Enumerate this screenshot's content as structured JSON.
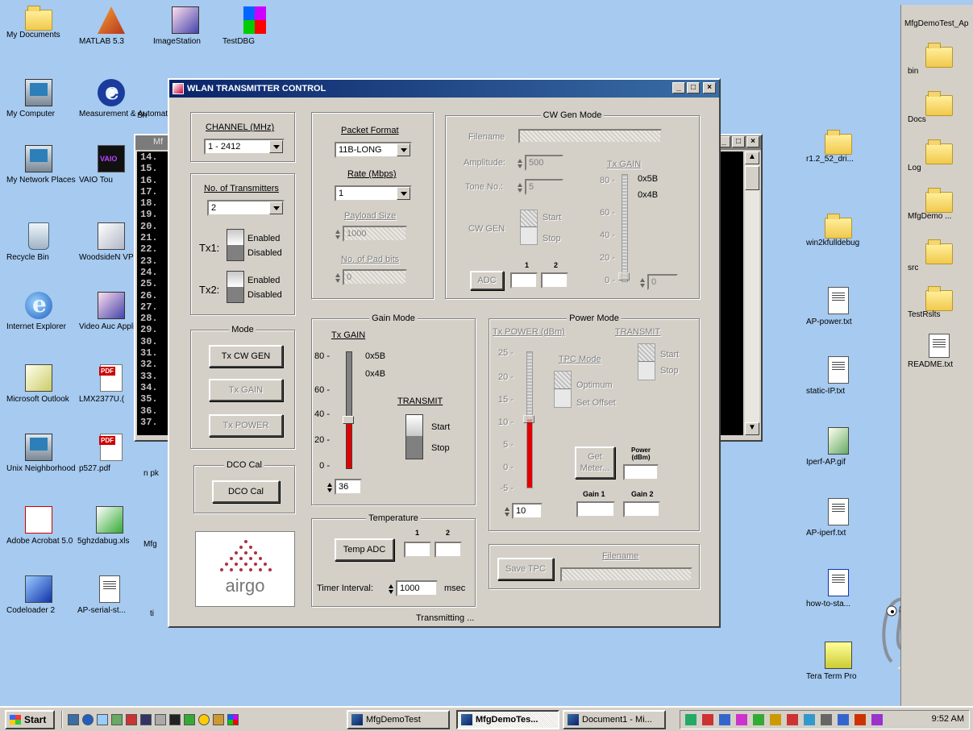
{
  "desktop": {
    "icons": [
      {
        "label": "My Documents"
      },
      {
        "label": "MATLAB 5.3"
      },
      {
        "label": "ImageStation"
      },
      {
        "label": "TestDBG"
      },
      {
        "label": "My Computer"
      },
      {
        "label": "Measurement & Automatio..."
      },
      {
        "label": "Sh"
      },
      {
        "label": "My Network Places"
      },
      {
        "label": "VAIO Tou"
      },
      {
        "label": "Recycle Bin"
      },
      {
        "label": "WoodsideN VPN"
      },
      {
        "label": "Internet Explorer"
      },
      {
        "label": "Video Auc Applicatio"
      },
      {
        "label": "Microsoft Outlook"
      },
      {
        "label": "LMX2377U.("
      },
      {
        "label": "Unix Neighborhood"
      },
      {
        "label": "p527.pdf"
      },
      {
        "label": "n pk"
      },
      {
        "label": "Adobe Acrobat 5.0"
      },
      {
        "label": "5ghzdabug.xls"
      },
      {
        "label": "Mfg"
      },
      {
        "label": "Codeloader 2"
      },
      {
        "label": "AP-serial-st..."
      },
      {
        "label": "ti"
      },
      {
        "label": "r1.2_52_dri..."
      },
      {
        "label": "win2kfulldebug"
      },
      {
        "label": "AP-power.txt"
      },
      {
        "label": "static-IP.txt"
      },
      {
        "label": "Iperf-AP.gif"
      },
      {
        "label": "AP-iperf.txt"
      },
      {
        "label": "how-to-sta..."
      },
      {
        "label": "Tera Term Pro"
      }
    ]
  },
  "right_panel": {
    "title": "MfgDemoTest_Ap",
    "items": [
      {
        "label": "bin"
      },
      {
        "label": "Docs"
      },
      {
        "label": "Log"
      },
      {
        "label": "MfgDemo ..."
      },
      {
        "label": "src"
      },
      {
        "label": "TestRslts"
      },
      {
        "label": "README.txt"
      }
    ]
  },
  "cmd_window": {
    "title": "Mf",
    "lines": [
      "14.",
      "15.",
      "16.",
      "17.",
      "18.",
      "19.",
      "20.",
      "21.",
      "22.",
      "23.",
      "24.",
      "25.",
      "26.",
      "27.",
      "28.",
      "29.",
      "30.",
      "31.",
      "32.",
      "33.",
      "34.",
      "35.",
      "36.",
      "37."
    ]
  },
  "dialog": {
    "title": "WLAN TRANSMITTER CONTROL",
    "channel": {
      "label": "CHANNEL (MHz)",
      "value": "1 - 2412"
    },
    "transmitters": {
      "label": "No. of Transmitters",
      "value": "2",
      "tx1_label": "Tx1:",
      "tx2_label": "Tx2:",
      "enabled": "Enabled",
      "disabled": "Disabled"
    },
    "mode": {
      "title": "Mode",
      "tx_cw_gen": "Tx CW GEN",
      "tx_gain": "Tx GAIN",
      "tx_power": "Tx POWER"
    },
    "dco_cal": {
      "title": "DCO Cal",
      "button": "DCO Cal"
    },
    "logo_text": "airgo",
    "packet": {
      "format_label": "Packet Format",
      "format_value": "11B-LONG",
      "rate_label": "Rate (Mbps)",
      "rate_value": "1",
      "payload_label": "Payload Size",
      "payload_value": "1000",
      "pad_label": "No. of Pad bits",
      "pad_value": "0"
    },
    "cw_gen": {
      "title": "CW Gen Mode",
      "filename_label": "Filename",
      "amplitude_label": "Amplitude:",
      "amplitude_value": "500",
      "tone_label": "Tone No.:",
      "tone_value": "5",
      "cw_gen_label": "CW GEN",
      "start": "Start",
      "stop": "Stop",
      "adc_button": "ADC",
      "col1": "1",
      "col2": "2",
      "txgain_label": "Tx GAIN",
      "ticks": [
        "80 -",
        "60 -",
        "40 -",
        "20 -",
        "0 -"
      ],
      "marker_high": "0x5B",
      "marker_low": "0x4B",
      "gain_value": "0"
    },
    "gain_mode": {
      "title": "Gain Mode",
      "tx_gain_label": "Tx GAIN",
      "ticks": [
        "80 -",
        "60 -",
        "40 -",
        "20 -",
        "0 -"
      ],
      "marker_high": "0x5B",
      "marker_low": "0x4B",
      "transmit_label": "TRANSMIT",
      "start": "Start",
      "stop": "Stop",
      "gain_value": "36",
      "level": 36
    },
    "power_mode": {
      "title": "Power Mode",
      "tx_power_label": "Tx POWER (dBm)",
      "transmit_label": "TRANSMIT",
      "tpc_mode_label": "TPC Mode",
      "optimum": "Optimum",
      "set_offset": "Set Offset",
      "start": "Start",
      "stop": "Stop",
      "ticks": [
        "25 -",
        "20 -",
        "15 -",
        "10 -",
        "5 -",
        "0 -",
        "-5 -"
      ],
      "get_meter_button": "Get Meter...",
      "power_dbm_label": "Power (dBm)",
      "gain1_label": "Gain 1",
      "gain2_label": "Gain 2",
      "spin_value": "10",
      "level": 10
    },
    "temperature": {
      "title": "Temperature",
      "temp_adc_button": "Temp ADC",
      "col1": "1",
      "col2": "2",
      "timer_label": "Timer Interval:",
      "timer_value": "1000",
      "timer_unit": "msec"
    },
    "file": {
      "save_button": "Save TPC",
      "filename_label": "Filename"
    },
    "status": "Transmitting ..."
  },
  "taskbar": {
    "start": "Start",
    "tasks": [
      {
        "label": "MfgDemoTest"
      },
      {
        "label": "MfgDemoTes..."
      },
      {
        "label": "Document1 - Mi..."
      }
    ],
    "clock": "9:52 AM"
  }
}
